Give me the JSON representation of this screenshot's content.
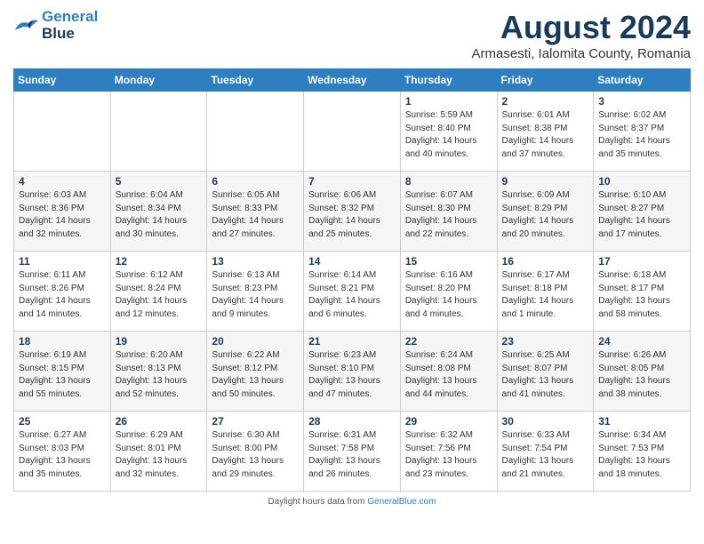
{
  "header": {
    "logo_line1": "General",
    "logo_line2": "Blue",
    "month_title": "August 2024",
    "location": "Armasesti, Ialomita County, Romania"
  },
  "days_of_week": [
    "Sunday",
    "Monday",
    "Tuesday",
    "Wednesday",
    "Thursday",
    "Friday",
    "Saturday"
  ],
  "weeks": [
    [
      {
        "day": "",
        "info": ""
      },
      {
        "day": "",
        "info": ""
      },
      {
        "day": "",
        "info": ""
      },
      {
        "day": "",
        "info": ""
      },
      {
        "day": "1",
        "info": "Sunrise: 5:59 AM\nSunset: 8:40 PM\nDaylight: 14 hours and 40 minutes."
      },
      {
        "day": "2",
        "info": "Sunrise: 6:01 AM\nSunset: 8:38 PM\nDaylight: 14 hours and 37 minutes."
      },
      {
        "day": "3",
        "info": "Sunrise: 6:02 AM\nSunset: 8:37 PM\nDaylight: 14 hours and 35 minutes."
      }
    ],
    [
      {
        "day": "4",
        "info": "Sunrise: 6:03 AM\nSunset: 8:36 PM\nDaylight: 14 hours and 32 minutes."
      },
      {
        "day": "5",
        "info": "Sunrise: 6:04 AM\nSunset: 8:34 PM\nDaylight: 14 hours and 30 minutes."
      },
      {
        "day": "6",
        "info": "Sunrise: 6:05 AM\nSunset: 8:33 PM\nDaylight: 14 hours and 27 minutes."
      },
      {
        "day": "7",
        "info": "Sunrise: 6:06 AM\nSunset: 8:32 PM\nDaylight: 14 hours and 25 minutes."
      },
      {
        "day": "8",
        "info": "Sunrise: 6:07 AM\nSunset: 8:30 PM\nDaylight: 14 hours and 22 minutes."
      },
      {
        "day": "9",
        "info": "Sunrise: 6:09 AM\nSunset: 8:29 PM\nDaylight: 14 hours and 20 minutes."
      },
      {
        "day": "10",
        "info": "Sunrise: 6:10 AM\nSunset: 8:27 PM\nDaylight: 14 hours and 17 minutes."
      }
    ],
    [
      {
        "day": "11",
        "info": "Sunrise: 6:11 AM\nSunset: 8:26 PM\nDaylight: 14 hours and 14 minutes."
      },
      {
        "day": "12",
        "info": "Sunrise: 6:12 AM\nSunset: 8:24 PM\nDaylight: 14 hours and 12 minutes."
      },
      {
        "day": "13",
        "info": "Sunrise: 6:13 AM\nSunset: 8:23 PM\nDaylight: 14 hours and 9 minutes."
      },
      {
        "day": "14",
        "info": "Sunrise: 6:14 AM\nSunset: 8:21 PM\nDaylight: 14 hours and 6 minutes."
      },
      {
        "day": "15",
        "info": "Sunrise: 6:16 AM\nSunset: 8:20 PM\nDaylight: 14 hours and 4 minutes."
      },
      {
        "day": "16",
        "info": "Sunrise: 6:17 AM\nSunset: 8:18 PM\nDaylight: 14 hours and 1 minute."
      },
      {
        "day": "17",
        "info": "Sunrise: 6:18 AM\nSunset: 8:17 PM\nDaylight: 13 hours and 58 minutes."
      }
    ],
    [
      {
        "day": "18",
        "info": "Sunrise: 6:19 AM\nSunset: 8:15 PM\nDaylight: 13 hours and 55 minutes."
      },
      {
        "day": "19",
        "info": "Sunrise: 6:20 AM\nSunset: 8:13 PM\nDaylight: 13 hours and 52 minutes."
      },
      {
        "day": "20",
        "info": "Sunrise: 6:22 AM\nSunset: 8:12 PM\nDaylight: 13 hours and 50 minutes."
      },
      {
        "day": "21",
        "info": "Sunrise: 6:23 AM\nSunset: 8:10 PM\nDaylight: 13 hours and 47 minutes."
      },
      {
        "day": "22",
        "info": "Sunrise: 6:24 AM\nSunset: 8:08 PM\nDaylight: 13 hours and 44 minutes."
      },
      {
        "day": "23",
        "info": "Sunrise: 6:25 AM\nSunset: 8:07 PM\nDaylight: 13 hours and 41 minutes."
      },
      {
        "day": "24",
        "info": "Sunrise: 6:26 AM\nSunset: 8:05 PM\nDaylight: 13 hours and 38 minutes."
      }
    ],
    [
      {
        "day": "25",
        "info": "Sunrise: 6:27 AM\nSunset: 8:03 PM\nDaylight: 13 hours and 35 minutes."
      },
      {
        "day": "26",
        "info": "Sunrise: 6:29 AM\nSunset: 8:01 PM\nDaylight: 13 hours and 32 minutes."
      },
      {
        "day": "27",
        "info": "Sunrise: 6:30 AM\nSunset: 8:00 PM\nDaylight: 13 hours and 29 minutes."
      },
      {
        "day": "28",
        "info": "Sunrise: 6:31 AM\nSunset: 7:58 PM\nDaylight: 13 hours and 26 minutes."
      },
      {
        "day": "29",
        "info": "Sunrise: 6:32 AM\nSunset: 7:56 PM\nDaylight: 13 hours and 23 minutes."
      },
      {
        "day": "30",
        "info": "Sunrise: 6:33 AM\nSunset: 7:54 PM\nDaylight: 13 hours and 21 minutes."
      },
      {
        "day": "31",
        "info": "Sunrise: 6:34 AM\nSunset: 7:53 PM\nDaylight: 13 hours and 18 minutes."
      }
    ]
  ],
  "footer": {
    "note": "Daylight hours",
    "url": "GeneralBlue.com"
  }
}
